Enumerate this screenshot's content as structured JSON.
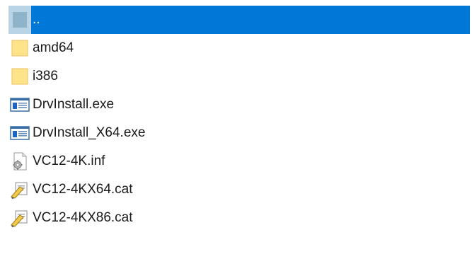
{
  "items": [
    {
      "name": "..",
      "icon": "parent-folder-icon",
      "selected": true
    },
    {
      "name": "amd64",
      "icon": "folder-icon",
      "selected": false
    },
    {
      "name": "i386",
      "icon": "folder-icon",
      "selected": false
    },
    {
      "name": "DrvInstall.exe",
      "icon": "exe-window-icon",
      "selected": false
    },
    {
      "name": "DrvInstall_X64.exe",
      "icon": "exe-window-icon",
      "selected": false
    },
    {
      "name": "VC12-4K.inf",
      "icon": "inf-gear-file-icon",
      "selected": false
    },
    {
      "name": "VC12-4KX64.cat",
      "icon": "catalog-file-icon",
      "selected": false
    },
    {
      "name": "VC12-4KX86.cat",
      "icon": "catalog-file-icon",
      "selected": false
    }
  ],
  "colors": {
    "selection": "#0078d7",
    "folder": "#ffd966",
    "folder_dark": "#e8b84a"
  }
}
